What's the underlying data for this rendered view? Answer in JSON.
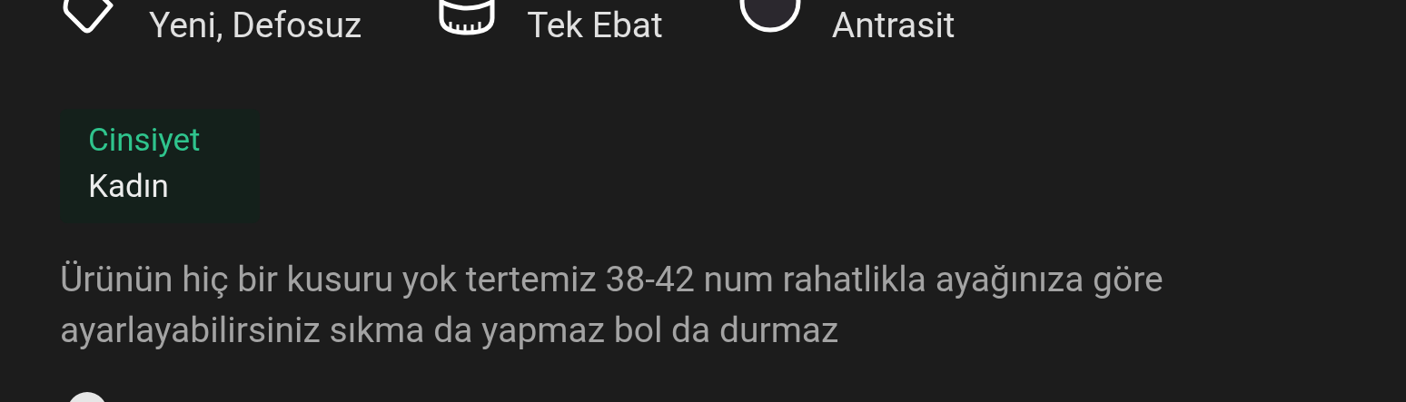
{
  "features": [
    {
      "kind": "condition",
      "label": "Yeni, Defosuz"
    },
    {
      "kind": "size",
      "label": "Tek Ebat"
    },
    {
      "kind": "color",
      "label": "Antrasit",
      "color": "#2b282e"
    }
  ],
  "attribute": {
    "label": "Cinsiyet",
    "value": "Kadın"
  },
  "description": "Ürünün hiç bir kusuru yok tertemiz 38-42 num rahatlikla ayağınıza göre ayarlayabilirsiniz sıkma da yapmaz bol da durmaz"
}
